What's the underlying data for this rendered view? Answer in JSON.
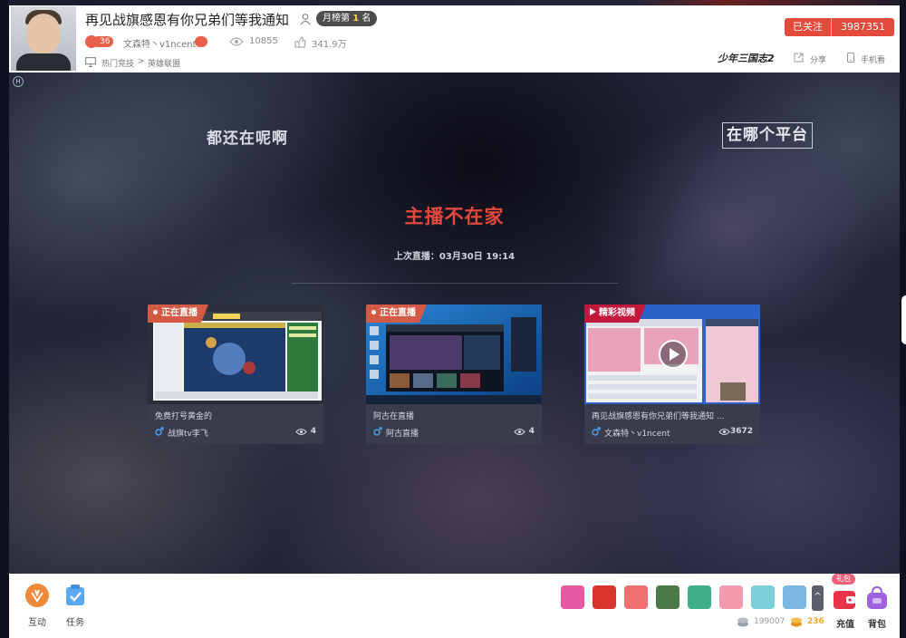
{
  "colors": {
    "accent_red": "#e34a3a",
    "offline_red": "#e2493b",
    "live_badge": "#d35a45",
    "highlight_badge": "#c3183b",
    "gold": "#f2a52a"
  },
  "header": {
    "title": "再见战旗感恩有你兄弟们等我通知",
    "rank_badge_prefix": "月榜第",
    "rank_badge_number": "1",
    "rank_badge_suffix": "名",
    "level": "36",
    "anchor_name": "文森特丶v1ncent",
    "viewers": "10855",
    "fans": "341.9万",
    "breadcrumb": {
      "category": "热门竞技",
      "separator": ">",
      "game": "英雄联盟"
    },
    "follow_label": "已关注",
    "follow_count": "3987351",
    "game_logo_text": "少年三国志2",
    "share_label": "分享",
    "phone_label": "手机看"
  },
  "stage": {
    "bg_left_text": "都还在呢啊",
    "bg_right_text": "在哪个平台",
    "offline_title": "主播不在家",
    "last_live": "上次直播：03月30日 19:14"
  },
  "cards": [
    {
      "badge": "正在直播",
      "title": "免费打号黄金的",
      "name": "战旗tv李飞",
      "count": "4"
    },
    {
      "badge": "正在直播",
      "title": "阿古在直播",
      "name": "阿古直播",
      "count": "4"
    },
    {
      "badge": "精彩视频",
      "title": "再见战旗感恩有你兄弟们等我通知 ...",
      "name": "文森特丶v1ncent",
      "count": "3672"
    }
  ],
  "bottom": {
    "interact_label": "互动",
    "task_label": "任务",
    "more_glyph": "^",
    "libao": "礼包",
    "recharge_label": "充值",
    "bag_label": "背包",
    "silver": "199007",
    "gold": "236"
  },
  "icons": [
    "avatar",
    "person-icon",
    "mic-icon",
    "message-icon",
    "eye-icon",
    "fans-icon",
    "monitor-icon",
    "share-icon",
    "phone-icon",
    "hd-icon",
    "male-icon",
    "play-icon",
    "interact-icon",
    "task-icon",
    "gift-icon",
    "wallet-icon",
    "bag-icon",
    "silver-coin-icon",
    "gold-coin-icon"
  ]
}
